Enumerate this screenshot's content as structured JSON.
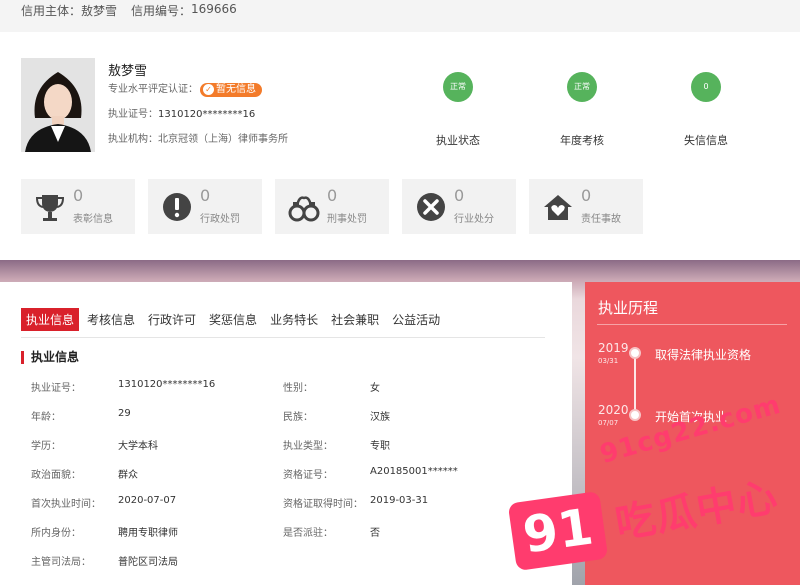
{
  "header": {
    "subject_label": "信用主体：",
    "subject_value": "敖梦雪",
    "code_label": "信用编号：",
    "code_value": "169666"
  },
  "profile": {
    "name": "敖梦雪",
    "evaluation_label": "专业水平评定认证：",
    "evaluation_badge": "暂无信息",
    "license_label": "执业证号：",
    "license_value": "1310120********16",
    "firm_label": "执业机构：",
    "firm_value": "北京冠领（上海）律师事务所"
  },
  "status": [
    {
      "value": "正常",
      "label": "执业状态"
    },
    {
      "value": "正常",
      "label": "年度考核"
    },
    {
      "value": "0",
      "label": "失信信息"
    }
  ],
  "tiles": [
    {
      "count": "0",
      "label": "表彰信息",
      "icon": "trophy-icon"
    },
    {
      "count": "0",
      "label": "行政处罚",
      "icon": "exclamation-icon"
    },
    {
      "count": "0",
      "label": "刑事处罚",
      "icon": "handcuffs-icon"
    },
    {
      "count": "0",
      "label": "行业处分",
      "icon": "x-circle-icon"
    },
    {
      "count": "0",
      "label": "责任事故",
      "icon": "house-heart-icon"
    }
  ],
  "tabs": [
    "执业信息",
    "考核信息",
    "行政许可",
    "奖惩信息",
    "业务特长",
    "社会兼职",
    "公益活动"
  ],
  "section_title": "执业信息",
  "info": [
    {
      "k1": "执业证号：",
      "v1": "1310120********16",
      "k2": "性别：",
      "v2": "女"
    },
    {
      "k1": "年龄：",
      "v1": "29",
      "k2": "民族：",
      "v2": "汉族"
    },
    {
      "k1": "学历：",
      "v1": "大学本科",
      "k2": "执业类型：",
      "v2": "专职"
    },
    {
      "k1": "政治面貌：",
      "v1": "群众",
      "k2": "资格证号：",
      "v2": "A20185001******"
    },
    {
      "k1": "首次执业时间：",
      "v1": "2020-07-07",
      "k2": "资格证取得时间：",
      "v2": "2019-03-31"
    },
    {
      "k1": "所内身份：",
      "v1": "聘用专职律师",
      "k2": "是否派驻：",
      "v2": "否"
    },
    {
      "k1": "主管司法局：",
      "v1": "普陀区司法局",
      "k2": "",
      "v2": ""
    }
  ],
  "history": {
    "title": "执业历程",
    "events": [
      {
        "year": "2019",
        "date": "03/31",
        "text": "取得法律执业资格"
      },
      {
        "year": "2020",
        "date": "07/07",
        "text": "开始首次执业"
      }
    ]
  },
  "watermark": {
    "url": "91cg22.com",
    "number": "91",
    "text": "吃瓜中心"
  },
  "colors": {
    "accent": "#d9212b",
    "status_green": "#56b35c",
    "side_panel": "#ee575e",
    "badge": "#f37b2a",
    "watermark": "#ff3c6e"
  }
}
